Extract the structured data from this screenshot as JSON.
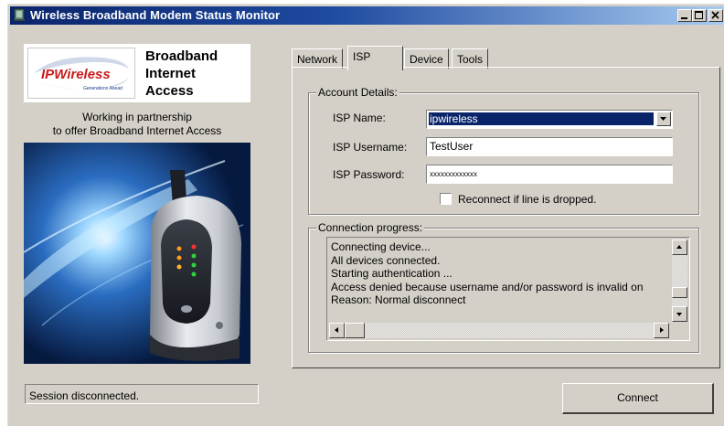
{
  "window": {
    "title": "Wireless Broadband Modem Status Monitor",
    "icon": "modem-app-icon",
    "controls": [
      "minimize-icon",
      "maximize-icon",
      "close-icon"
    ]
  },
  "branding": {
    "logo_name": "IPWireless",
    "logo_tagline": "Generations Ahead",
    "product_title": "Broadband\nInternet\nAccess",
    "partnership_line1": "Working in partnership",
    "partnership_line2": "to offer Broadband Internet Access"
  },
  "status": {
    "text": "Session disconnected."
  },
  "tabs": [
    {
      "label": "Network",
      "active": false
    },
    {
      "label": "ISP",
      "active": true
    },
    {
      "label": "Device",
      "active": false
    },
    {
      "label": "Tools",
      "active": false
    }
  ],
  "account": {
    "group_label": "Account Details:",
    "isp_name_label": "ISP Name:",
    "isp_name_value": "ipwireless",
    "isp_username_label": "ISP Username:",
    "isp_username_value": "TestUser",
    "isp_password_label": "ISP Password:",
    "isp_password_value": "xxxxxxxxxxxxx",
    "reconnect_label": "Reconnect if line is dropped.",
    "reconnect_checked": false
  },
  "progress": {
    "group_label": "Connection progress:",
    "lines": [
      "Connecting device...",
      "All devices connected.",
      "Starting authentication ...",
      "Access denied because username and/or password is invalid on",
      "Reason: Normal disconnect"
    ]
  },
  "actions": {
    "connect_label": "Connect"
  },
  "colors": {
    "title_bar": "#0a246a",
    "window_bg": "#d4d0c8",
    "selection": "#0a246a",
    "logo_red": "#cc1b1b",
    "logo_blue": "#1a3b8c"
  }
}
